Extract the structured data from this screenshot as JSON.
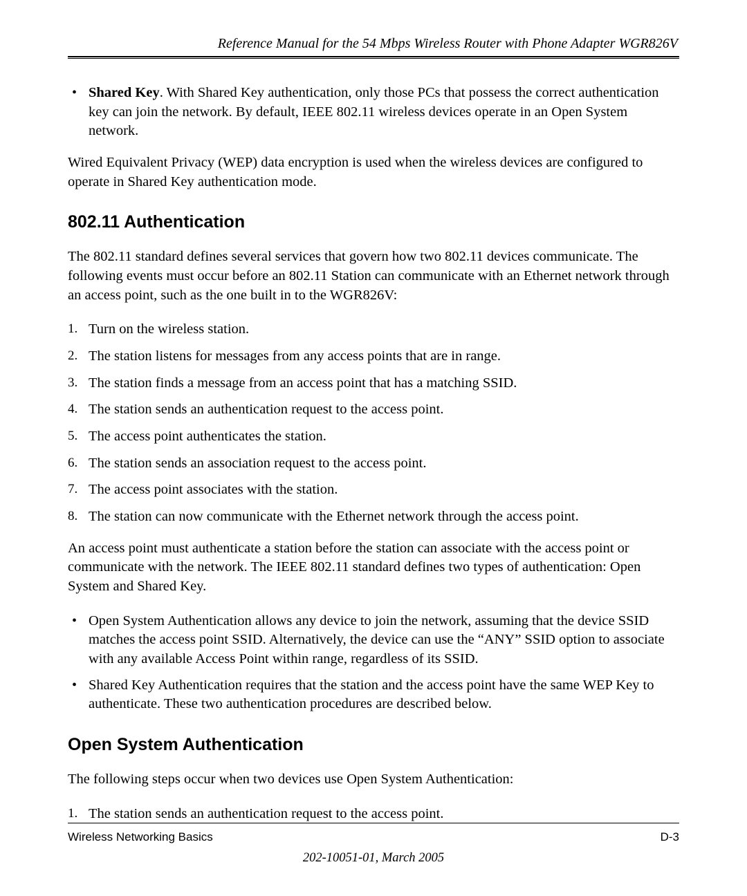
{
  "header": {
    "title": "Reference Manual for the 54 Mbps Wireless Router with Phone Adapter WGR826V"
  },
  "intro_bullet": {
    "bold": "Shared Key",
    "rest": ". With Shared Key authentication, only those PCs that possess the correct authentication key can join the network. By default, IEEE 802.11 wireless devices operate in an Open System network."
  },
  "wep_para": "Wired Equivalent Privacy (WEP) data encryption is used when the wireless devices are configured to operate in Shared Key authentication mode.",
  "section1": {
    "heading": "802.11 Authentication",
    "intro": "The 802.11 standard defines several services that govern how two 802.11 devices communicate. The following events must occur before an 802.11 Station can communicate with an Ethernet network through an access point, such as the one built in to the WGR826V:",
    "steps": [
      "Turn on the wireless station.",
      "The station listens for messages from any access points that are in range.",
      "The station finds a message from an access point that has a matching SSID.",
      "The station sends an authentication request to the access point.",
      "The access point authenticates the station.",
      "The station sends an association request to the access point.",
      "The access point associates with the station.",
      "The station can now communicate with the Ethernet network through the access point."
    ],
    "para2": "An access point must authenticate a station before the station can associate with the access point or communicate with the network. The IEEE 802.11 standard defines two types of authentication: Open System and Shared Key.",
    "bullets": [
      "Open System Authentication allows any device to join the network, assuming that the device SSID matches the access point SSID. Alternatively, the device can use the “ANY” SSID option to associate with any available Access Point within range, regardless of its SSID.",
      "Shared Key Authentication requires that the station and the access point have the same WEP Key to authenticate. These two authentication procedures are described below."
    ]
  },
  "section2": {
    "heading": "Open System Authentication",
    "intro": "The following steps occur when two devices use Open System Authentication:",
    "steps": [
      "The station sends an authentication request to the access point."
    ]
  },
  "footer": {
    "left": "Wireless Networking Basics",
    "right": "D-3",
    "docid": "202-10051-01, March 2005"
  }
}
